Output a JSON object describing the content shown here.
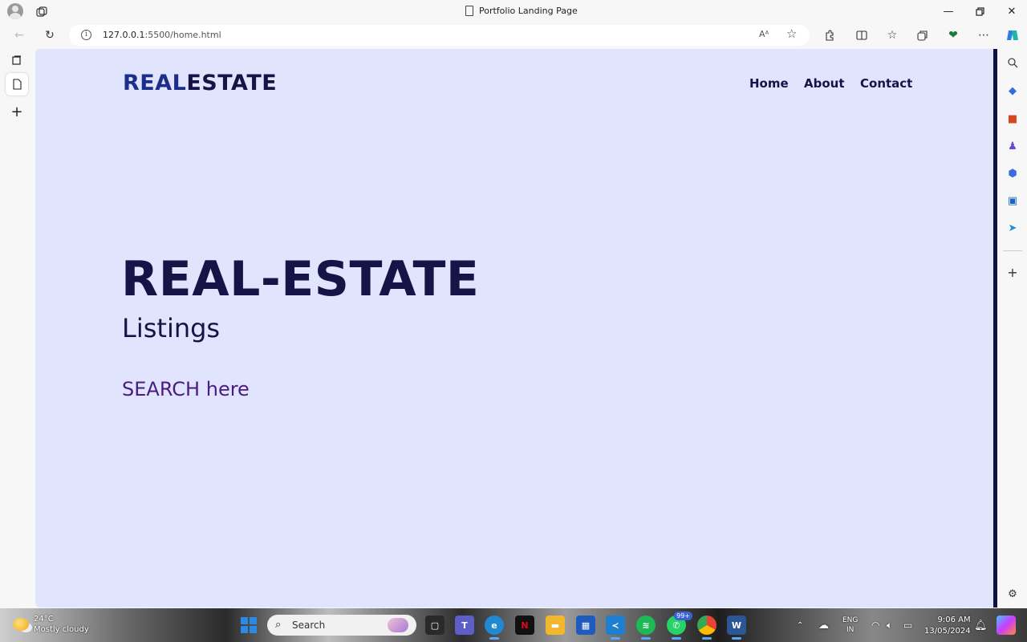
{
  "browser": {
    "tab_title": "Portfolio Landing Page",
    "url_host": "127.0.0.1",
    "url_rest": ":5500/home.html",
    "read_aloud_label": "A"
  },
  "site": {
    "logo_part1": "REAL",
    "logo_part2": "ESTATE",
    "nav": {
      "home": "Home",
      "about": "About",
      "contact": "Contact"
    },
    "hero_title": "REAL-ESTATE",
    "hero_subtitle": "Listings",
    "hero_search": "SEARCH here"
  },
  "taskbar": {
    "weather_temp": "24°C",
    "weather_desc": "Mostly cloudy",
    "search_placeholder": "Search",
    "whatsapp_badge": "99+",
    "lang_line1": "ENG",
    "lang_line2": "IN",
    "time": "9:06 AM",
    "date": "13/05/2024"
  },
  "colors": {
    "page_bg": "#e0e5fd",
    "logo_primary": "#1c2e8a",
    "text_dark": "#141446",
    "search_purple": "#4b1c80"
  }
}
